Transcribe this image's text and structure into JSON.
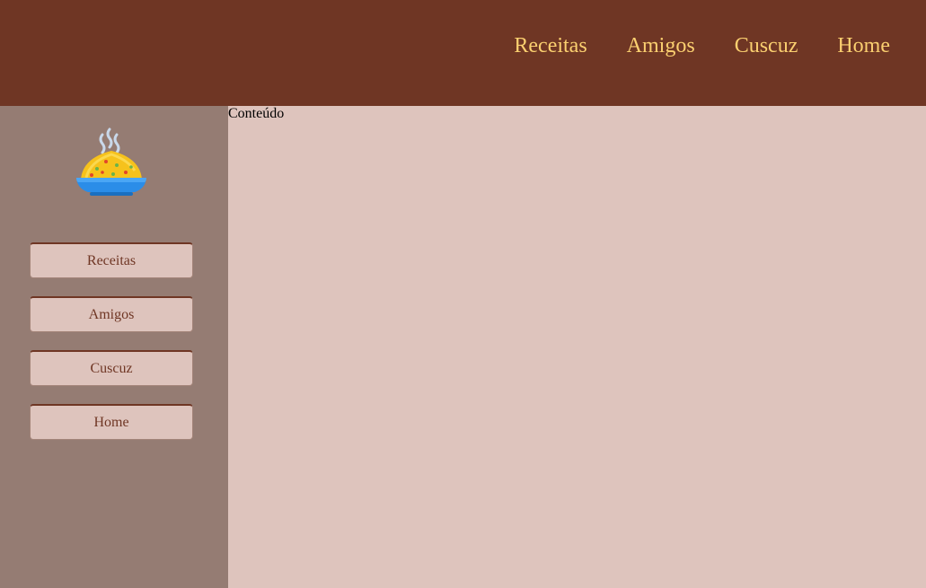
{
  "header": {
    "nav": [
      "Receitas",
      "Amigos",
      "Cuscuz",
      "Home"
    ]
  },
  "sidebar": {
    "logo_icon": "rice-bowl-icon",
    "buttons": [
      "Receitas",
      "Amigos",
      "Cuscuz",
      "Home"
    ]
  },
  "main": {
    "content_text": "Conteúdo"
  },
  "colors": {
    "header_bg": "#6f3624",
    "nav_text": "#fbd070",
    "sidebar_bg": "#957c73",
    "content_bg": "#dec4bd",
    "button_text": "#6f3624"
  }
}
